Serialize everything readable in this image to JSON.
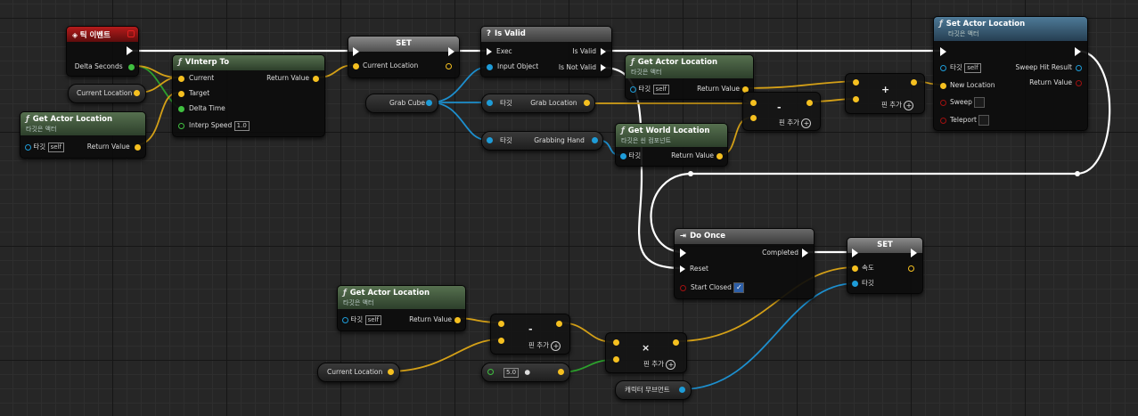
{
  "colors": {
    "exec": "#ffffff",
    "vector": "#f5c020",
    "object": "#1e9cd8",
    "float": "#40c040",
    "bool": "#8a0000",
    "wire_vector": "#d4a017",
    "wire_object": "#1d8fce"
  },
  "tick_event": {
    "title": "틱 이벤트",
    "delta_seconds": "Delta Seconds"
  },
  "set1": {
    "title": "SET",
    "current_location": "Current Location"
  },
  "is_valid": {
    "title": "Is Valid",
    "exec": "Exec",
    "input_object": "Input Object",
    "is_valid": "Is Valid",
    "is_not_valid": "Is Not Valid"
  },
  "set_actor_location": {
    "title": "Set Actor Location",
    "subtitle": "타깃은 액터",
    "target": "타깃",
    "self": "self",
    "new_location": "New Location",
    "sweep": "Sweep",
    "teleport": "Teleport",
    "sweep_hit_result": "Sweep Hit Result",
    "return_value": "Return Value"
  },
  "current_location_var1": {
    "label": "Current Location"
  },
  "vinterp": {
    "title": "VInterp To",
    "current": "Current",
    "target": "Target",
    "delta_time": "Delta Time",
    "interp_speed": "Interp Speed",
    "interp_speed_value": "1.0",
    "return_value": "Return Value"
  },
  "get_actor_location1": {
    "title": "Get Actor Location",
    "subtitle": "타깃은 액터",
    "target": "타깃",
    "self": "self",
    "return_value": "Return Value"
  },
  "grab_cube": {
    "label": "Grab Cube"
  },
  "get_grab_location": {
    "target": "타깃",
    "label": "Grab Location"
  },
  "get_grabbing_hand": {
    "target": "타깃",
    "label": "Grabbing Hand"
  },
  "get_actor_location2": {
    "title": "Get Actor Location",
    "subtitle": "타깃은 액터",
    "target": "타깃",
    "self": "self",
    "return_value": "Return Value"
  },
  "get_world_location": {
    "title": "Get World Location",
    "subtitle": "타깃은 씬 컴포넌트",
    "target": "타깃",
    "return_value": "Return Value"
  },
  "subtract1": {
    "symbol": "-",
    "add_pin": "핀 추가"
  },
  "add1": {
    "symbol": "+",
    "add_pin": "핀 추가"
  },
  "do_once": {
    "title": "Do Once",
    "completed": "Completed",
    "reset": "Reset",
    "start_closed": "Start Closed",
    "start_closed_checked": true
  },
  "set2": {
    "title": "SET",
    "location": "속도",
    "target": "타깃"
  },
  "get_actor_location3": {
    "title": "Get Actor Location",
    "subtitle": "타깃은 액터",
    "target": "타깃",
    "self": "self",
    "return_value": "Return Value"
  },
  "subtract2": {
    "symbol": "-",
    "add_pin": "핀 추가"
  },
  "current_location_var2": {
    "label": "Current Location"
  },
  "float_const": {
    "value": "5.0"
  },
  "multiply": {
    "symbol": "×",
    "add_pin": "핀 추가"
  },
  "character_movement": {
    "label": "캐릭터 무브먼트"
  }
}
